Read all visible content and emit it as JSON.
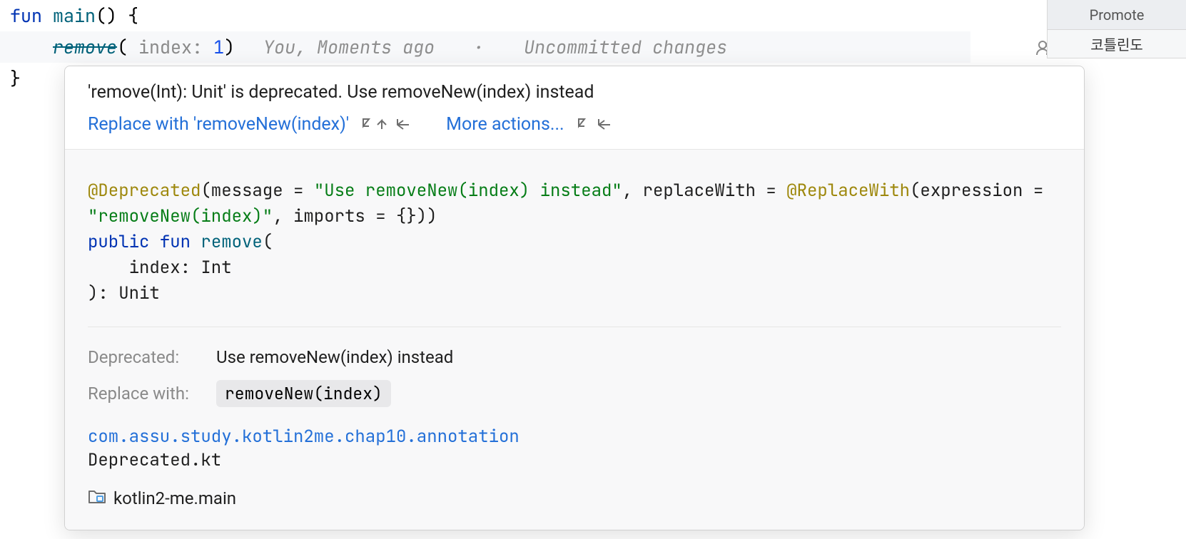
{
  "editor": {
    "line1": {
      "kw": "fun",
      "fn": "main",
      "parens": "()",
      "brace": "{"
    },
    "line2": {
      "call": "remove",
      "paramHint": "index:",
      "arg": "1",
      "inlayAuthor": "You, Moments ago",
      "inlaySep": "·",
      "inlayStatus": "Uncommitted changes"
    },
    "line3": {
      "brace": "}"
    }
  },
  "popup": {
    "title": "'remove(Int): Unit' is deprecated. Use removeNew(index) instead",
    "replaceAction": "Replace with 'removeNew(index)'",
    "moreActions": "More actions...",
    "signature": {
      "anno1": "@Deprecated",
      "p_message": "(message = ",
      "str1": "\"Use removeNew(index) instead\"",
      "mid1": ", replaceWith = ",
      "anno2": "@ReplaceWith",
      "p_expr": "(expression = ",
      "str2": "\"removeNew(index)\"",
      "mid2": ", imports = {}))",
      "kw_public": "public",
      "kw_fun": "fun",
      "fn_name": "remove",
      "open_paren": "(",
      "indent_param": "    index: Int",
      "close": "): Unit"
    },
    "deprecatedLabel": "Deprecated:",
    "deprecatedValue": "Use removeNew(index) instead",
    "replaceWithLabel": "Replace with:",
    "replaceWithCode": "removeNew(index)",
    "package": "com.assu.study.kotlin2me.chap10.annotation",
    "file": "Deprecated.kt",
    "module": "kotlin2-me.main"
  },
  "rightPanel": {
    "promote": "Promote",
    "korean": "코틀린도"
  }
}
